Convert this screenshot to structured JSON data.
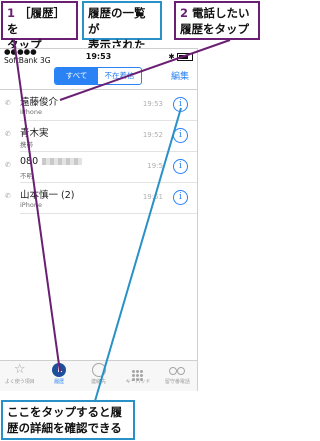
{
  "callouts": {
    "c1_num": "1",
    "c1_text": "［履歴］を\nタップ",
    "c_list_text": "履歴の一覧が\n表示された",
    "c2_num": "2",
    "c2_text": "電話したい\n履歴をタップ",
    "c_bottom_text": "ここをタップすると履\n歴の詳細を確認できる"
  },
  "status_bar": {
    "carrier": "●●●●● SoftBank  3G",
    "time": "19:53",
    "bt": "✱"
  },
  "nav": {
    "segment_all": "すべて",
    "segment_missed": "不在着信",
    "edit": "編集"
  },
  "calls": [
    {
      "name": "遠藤俊介",
      "type": "iPhone",
      "time": "19:53"
    },
    {
      "name": "青木実",
      "type": "携帯",
      "time": "19:52"
    },
    {
      "name": "080",
      "type": "不明",
      "time": "19:5"
    },
    {
      "name": "山本慎一 (2)",
      "type": "iPhone",
      "time": "19:51"
    }
  ],
  "tabs": [
    {
      "label": "よく使う項目",
      "icon": "star-icon"
    },
    {
      "label": "履歴",
      "icon": "recents-clock-icon"
    },
    {
      "label": "連絡先",
      "icon": "contacts-icon"
    },
    {
      "label": "キーパッド",
      "icon": "keypad-icon"
    },
    {
      "label": "留守番電話",
      "icon": "voicemail-icon"
    }
  ],
  "colors": {
    "callout_purple": "#6b1f73",
    "callout_blue": "#2a90c8",
    "ios_blue": "#2a82f5"
  }
}
